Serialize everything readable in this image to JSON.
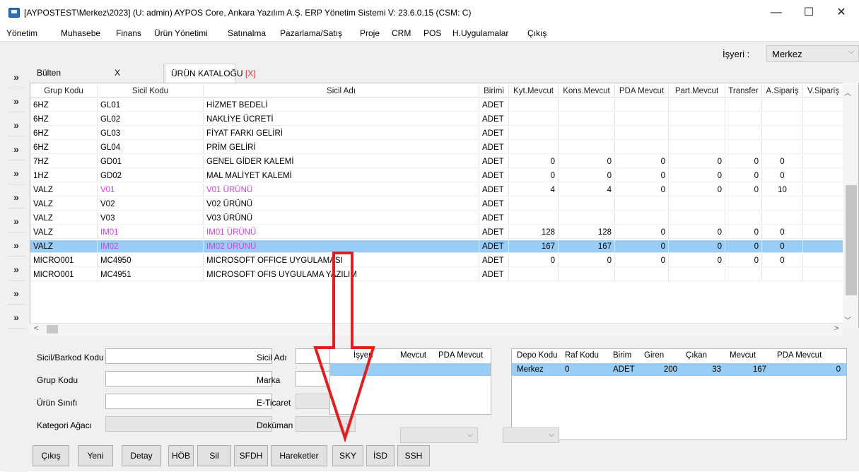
{
  "window": {
    "title": "[AYPOSTEST\\Merkez\\2023] (U: admin) AYPOS Core, Ankara Yazılım A.Ş. ERP Yönetim Sistemi V: 23.6.0.15 (CSM: C)",
    "minimize": "—",
    "maximize": "☐",
    "close": "✕"
  },
  "menu": [
    "Yönetim",
    "Muhasebe",
    "Finans",
    "Ürün Yönetimi",
    "Satınalma",
    "Pazarlama/Satış",
    "Proje",
    "CRM",
    "POS",
    "H.Uygulamalar",
    "Çıkış"
  ],
  "workplace": {
    "label": "İşyeri :",
    "value": "Merkez",
    "chevron": "⌵"
  },
  "rail": {
    "icon": "»"
  },
  "tabs": {
    "bulten": {
      "label": "Bülten",
      "close": "X"
    },
    "katalog": {
      "label": "ÜRÜN KATALOĞU",
      "close": "[X]"
    }
  },
  "grid": {
    "headers": [
      "Grup Kodu",
      "Sicil Kodu",
      "Sicil Adı",
      "Birimi",
      "Kyt.Mevcut",
      "Kons.Mevcut",
      "PDA Mevcut",
      "Part.Mevcut",
      "Transfer",
      "A.Sipariş",
      "V.Sipariş"
    ],
    "rows": [
      {
        "grup": "6HZ",
        "sicil_kodu": "GL01",
        "sicil_adi": "HİZMET BEDELİ",
        "birimi": "ADET",
        "kyt": "",
        "kons": "",
        "pda": "",
        "part": "",
        "transfer": "",
        "asip": ""
      },
      {
        "grup": "6HZ",
        "sicil_kodu": "GL02",
        "sicil_adi": "NAKLİYE ÜCRETİ",
        "birimi": "ADET",
        "kyt": "",
        "kons": "",
        "pda": "",
        "part": "",
        "transfer": "",
        "asip": ""
      },
      {
        "grup": "6HZ",
        "sicil_kodu": "GL03",
        "sicil_adi": "FİYAT FARKI GELİRİ",
        "birimi": "ADET",
        "kyt": "",
        "kons": "",
        "pda": "",
        "part": "",
        "transfer": "",
        "asip": ""
      },
      {
        "grup": "6HZ",
        "sicil_kodu": "GL04",
        "sicil_adi": "PRİM GELİRİ",
        "birimi": "ADET",
        "kyt": "",
        "kons": "",
        "pda": "",
        "part": "",
        "transfer": "",
        "asip": ""
      },
      {
        "grup": "7HZ",
        "sicil_kodu": "GD01",
        "sicil_adi": "GENEL GİDER KALEMİ",
        "birimi": "ADET",
        "kyt": "0",
        "kons": "0",
        "pda": "0",
        "part": "0",
        "transfer": "0",
        "asip": "0"
      },
      {
        "grup": "1HZ",
        "sicil_kodu": "GD02",
        "sicil_adi": "MAL MALİYET KALEMİ",
        "birimi": "ADET",
        "kyt": "0",
        "kons": "0",
        "pda": "0",
        "part": "0",
        "transfer": "0",
        "asip": "0"
      },
      {
        "grup": "VALZ",
        "sicil_kodu": "V01",
        "sicil_adi": "V01 ÜRÜNÜ",
        "birimi": "ADET",
        "kyt": "4",
        "kons": "4",
        "pda": "0",
        "part": "0",
        "transfer": "0",
        "asip": "10",
        "pink": true
      },
      {
        "grup": "VALZ",
        "sicil_kodu": "V02",
        "sicil_adi": "V02 ÜRÜNÜ",
        "birimi": "ADET",
        "kyt": "",
        "kons": "",
        "pda": "",
        "part": "",
        "transfer": "",
        "asip": ""
      },
      {
        "grup": "VALZ",
        "sicil_kodu": "V03",
        "sicil_adi": "V03 ÜRÜNÜ",
        "birimi": "ADET",
        "kyt": "",
        "kons": "",
        "pda": "",
        "part": "",
        "transfer": "",
        "asip": ""
      },
      {
        "grup": "VALZ",
        "sicil_kodu": "IM01",
        "sicil_adi": "IM01 ÜRÜNÜ",
        "birimi": "ADET",
        "kyt": "128",
        "kons": "128",
        "pda": "0",
        "part": "0",
        "transfer": "0",
        "asip": "0",
        "pink": true
      },
      {
        "grup": "VALZ",
        "sicil_kodu": "IM02",
        "sicil_adi": "IM02 ÜRÜNÜ",
        "birimi": "ADET",
        "kyt": "167",
        "kons": "167",
        "pda": "0",
        "part": "0",
        "transfer": "0",
        "asip": "0",
        "pink": true,
        "selected": true
      },
      {
        "grup": "MICRO001",
        "sicil_kodu": "MC4950",
        "sicil_adi": "MICROSOFT OFFICE UYGULAMASI",
        "birimi": "ADET",
        "kyt": "0",
        "kons": "0",
        "pda": "0",
        "part": "0",
        "transfer": "0",
        "asip": "0"
      },
      {
        "grup": "MICRO001",
        "sicil_kodu": "MC4951",
        "sicil_adi": "MICROSOFT OFIS UYGULAMA YAZILIM",
        "birimi": "ADET",
        "kyt": "",
        "kons": "",
        "pda": "",
        "part": "",
        "transfer": "",
        "asip": ""
      }
    ],
    "scroll_up": "︿",
    "scroll_down": "﹀",
    "scroll_left": "<",
    "scroll_right": ">"
  },
  "form": {
    "sicil_barkod_label": "Sicil/Barkod Kodu",
    "grup_kodu_label": "Grup Kodu",
    "urun_sinifi_label": "Ürün Sınıfı",
    "kategori_label": "Kategori Ağacı",
    "sicil_adi_label": "Sicil Adı",
    "marka_label": "Marka",
    "eticaret_label": "E-Ticaret",
    "dokuman_label": "Doküman",
    "chevron": "⌵"
  },
  "stock_grid": {
    "headers": [
      "İşyeri",
      "Mevcut",
      "PDA Mevcut"
    ]
  },
  "depot_grid": {
    "headers": [
      "Depo Kodu",
      "Raf Kodu",
      "Birim",
      "Giren",
      "Çıkan",
      "Mevcut",
      "PDA Mevcut"
    ],
    "row": {
      "depo": "Merkez",
      "raf": "0",
      "birim": "ADET",
      "giren": "200",
      "cikan": "33",
      "mevcut": "167",
      "pda": "0"
    }
  },
  "buttons": [
    "Çıkış",
    "Yeni",
    "Detay",
    "HÖB",
    "Sil",
    "SFDH",
    "Hareketler",
    "SKY",
    "İSD",
    "SSH"
  ],
  "colors": {
    "selection": "#99cdf5",
    "pink_text": "#d33ee2",
    "arrow": "#e02020",
    "tab_close": "#e0312f"
  }
}
